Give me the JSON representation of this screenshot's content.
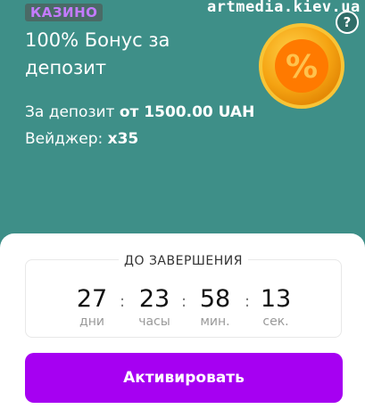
{
  "promo": {
    "badge": "КАЗИНО",
    "watermark": "artmedia.kiev.ua",
    "help_glyph": "?",
    "title": "100% Бонус за депозит",
    "deposit_prefix": "За депозит ",
    "deposit_value": "от 1500.00 UAH",
    "wager_prefix": "Вейджер: ",
    "wager_value": "x35",
    "coin_symbol": "%"
  },
  "timer": {
    "label": "ДО ЗАВЕРШЕНИЯ",
    "separator": ":",
    "units": [
      {
        "value": "27",
        "label": "дни"
      },
      {
        "value": "23",
        "label": "часы"
      },
      {
        "value": "58",
        "label": "мин."
      },
      {
        "value": "13",
        "label": "сек."
      }
    ]
  },
  "action": {
    "label": "Активировать"
  },
  "colors": {
    "background": "#3e8f88",
    "badge_text": "#c47bff",
    "button": "#a600f2",
    "coin": "#f7a41c"
  }
}
